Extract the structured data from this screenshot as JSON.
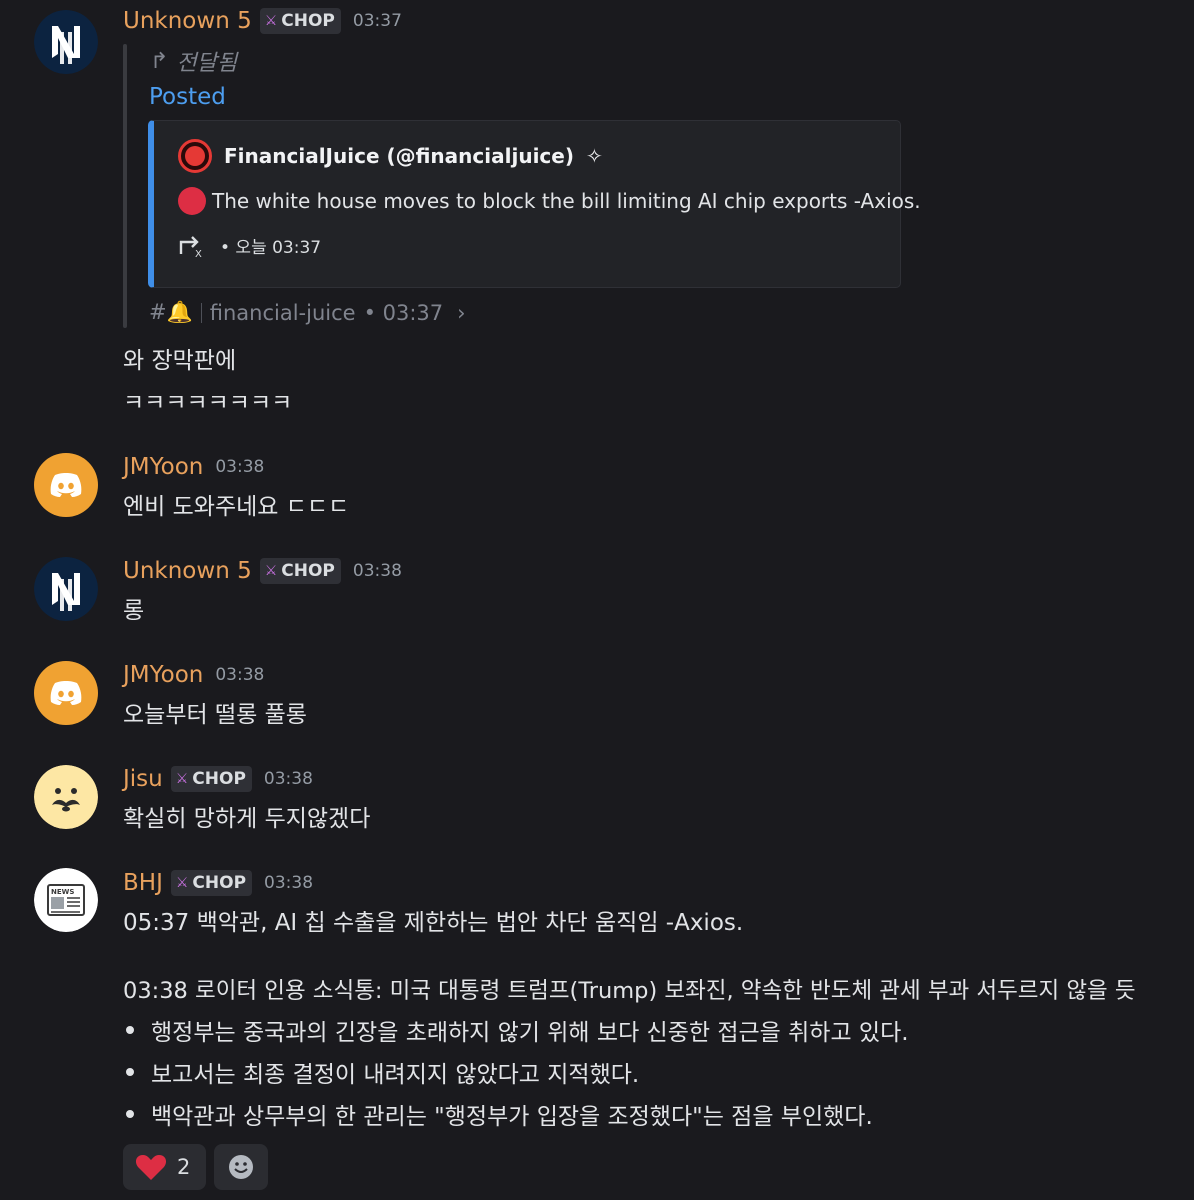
{
  "messages": [
    {
      "username": "Unknown 5",
      "badge": "CHOP",
      "time": "03:37",
      "avatar": "ny-yankees-logo",
      "forwarded_label": "전달됨",
      "posted_label": "Posted",
      "embed": {
        "author": "FinancialJuice (@financialjuice)",
        "description": "The white house moves to block the bill limiting AI chip exports -Axios.",
        "footer": "• 오늘 03:37"
      },
      "source_channel": "financial-juice",
      "source_time": "• 03:37",
      "lines": [
        "와 장막판에",
        "ㅋㅋㅋㅋㅋㅋㅋㅋ"
      ]
    },
    {
      "username": "JMYoon",
      "time": "03:38",
      "avatar": "discord-logo",
      "text": "엔비 도와주네요 ㄷㄷㄷ"
    },
    {
      "username": "Unknown 5",
      "badge": "CHOP",
      "time": "03:38",
      "avatar": "ny-yankees-logo",
      "text": "롱"
    },
    {
      "username": "JMYoon",
      "time": "03:38",
      "avatar": "discord-logo",
      "text": "오늘부터 떨롱 풀롱"
    },
    {
      "username": "Jisu",
      "badge": "CHOP",
      "time": "03:38",
      "avatar": "mustache-face",
      "text": "확실히 망하게 두지않겠다"
    },
    {
      "username": "BHJ",
      "badge": "CHOP",
      "time": "03:38",
      "avatar": "newspaper-icon",
      "line1": "05:37 백악관, AI 칩 수출을 제한하는 법안 차단 움직임 -Axios.",
      "line2": "03:38 로이터 인용 소식통: 미국 대통령 트럼프(Trump) 보좌진, 약속한 반도체 관세 부과 서두르지 않을 듯",
      "bullets": [
        "행정부는 중국과의 긴장을 초래하지 않기 위해 보다 신중한 접근을 취하고 있다.",
        "보고서는 최종 결정이 내려지지 않았다고 지적했다.",
        "백악관과 상무부의 한 관리는 \"행정부가 입장을 조정했다\"는 점을 부인했다."
      ],
      "reactions": [
        {
          "emoji": "heart",
          "count": "2"
        },
        {
          "emoji": "add-reaction"
        }
      ]
    }
  ],
  "colors": {
    "background": "#1a1a1e",
    "username": "#e8a15d",
    "link": "#4d9ef0",
    "embed_accent": "#3f8ee8"
  }
}
